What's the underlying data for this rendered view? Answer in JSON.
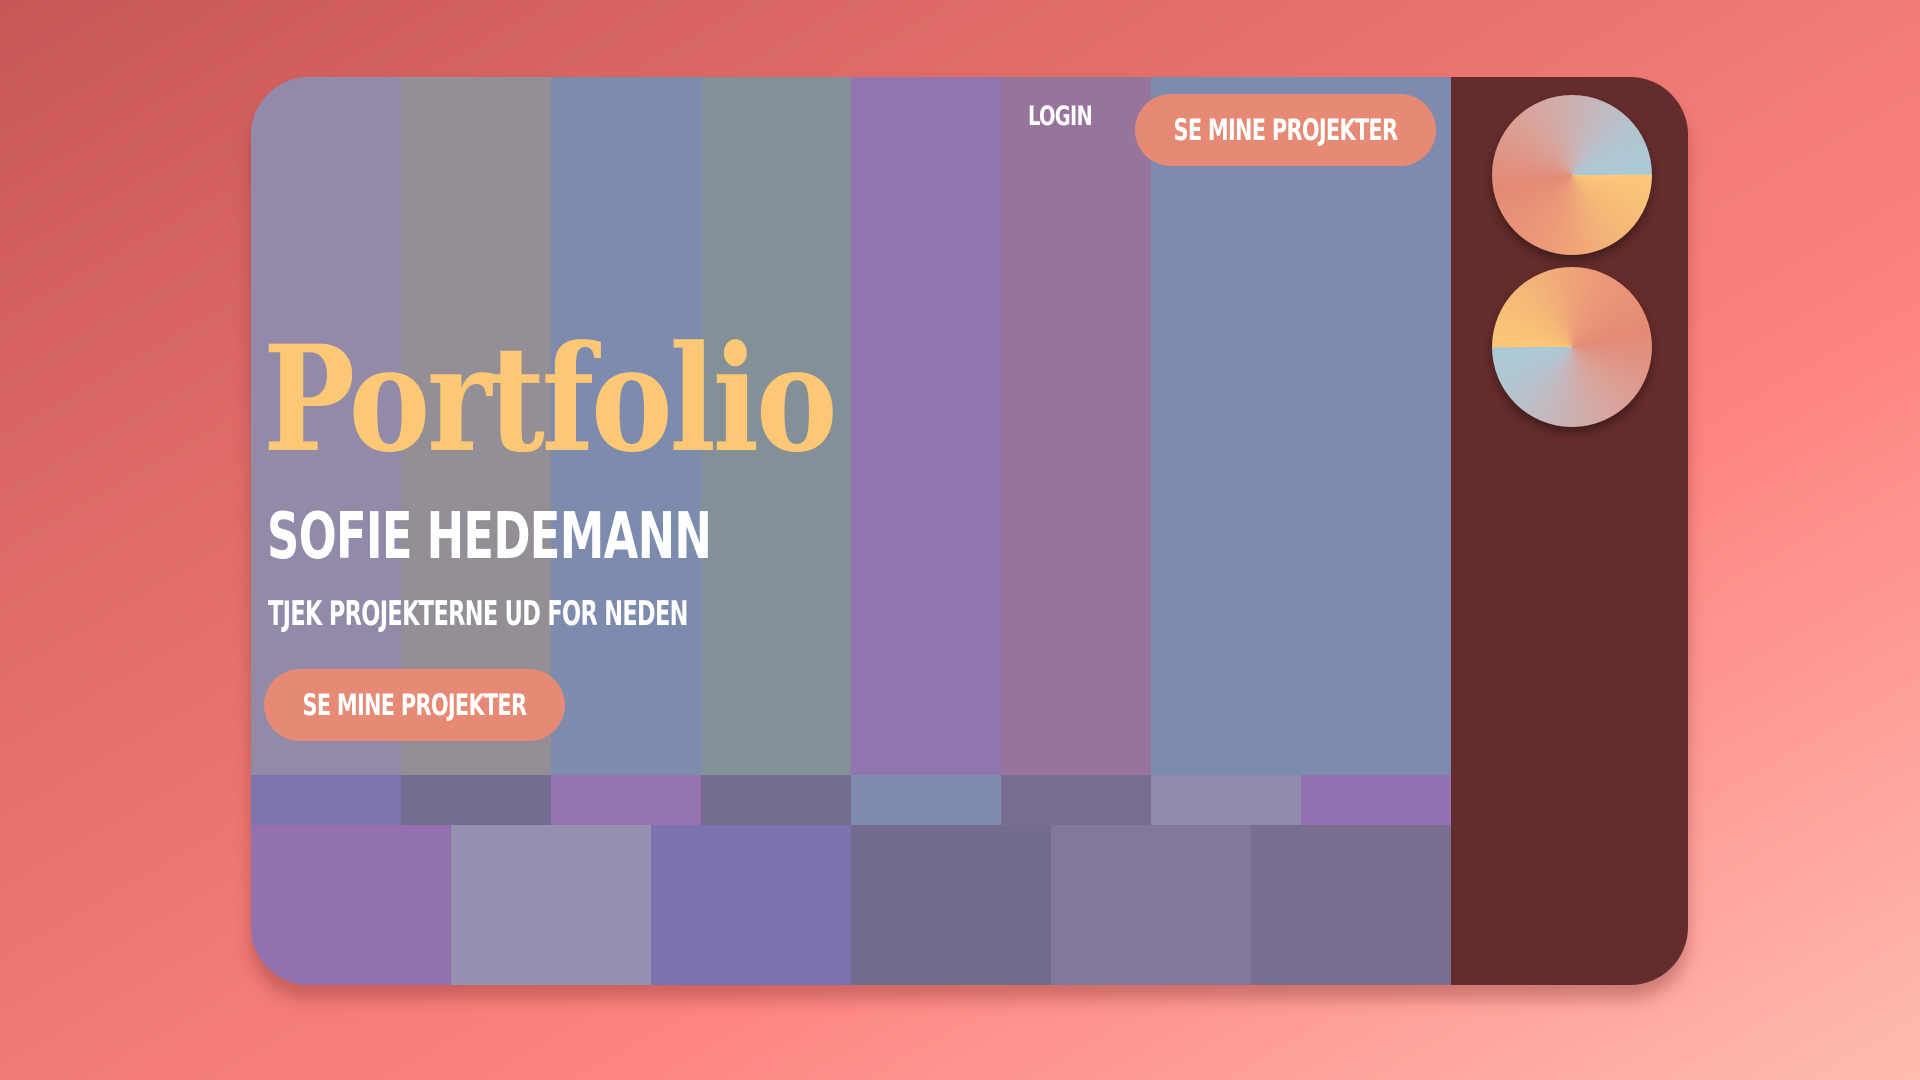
{
  "nav": {
    "login_label": "LOGIN",
    "cta_label": "SE MINE PROJEKTER"
  },
  "hero": {
    "title": "Portfolio",
    "name": "SOFIE HEDEMANN",
    "subtitle": "TJEK PROJEKTERNE UD FOR NEDEN",
    "cta_label": "SE MINE PROJEKTER"
  },
  "colors": {
    "background_gradient": [
      "#c85656",
      "#fd8480",
      "#ffbcb1"
    ],
    "sidebar": "#652c2c",
    "accent_yellow": "#fcc875",
    "button": "#e68a75",
    "text": "#ffffff",
    "stripes_top": [
      "#938aaa",
      "#948f97",
      "#7c8bae",
      "#849097",
      "#9274ae",
      "#97749c",
      "#7c8bae",
      "#7e8bae"
    ],
    "stripes_middle": [
      "#7d73ae",
      "#756d8f",
      "#9674b0",
      "#756d8f",
      "#7e8bae",
      "#7a6e90",
      "#928aab",
      "#9272b0"
    ],
    "stripes_bottom": [
      "#9370ae",
      "#9890b1",
      "#7c72b0",
      "#736c8c",
      "#827899",
      "#7a6e90"
    ]
  },
  "sidebar": {
    "discs": [
      "conic-gradient-disc",
      "conic-gradient-disc"
    ]
  }
}
